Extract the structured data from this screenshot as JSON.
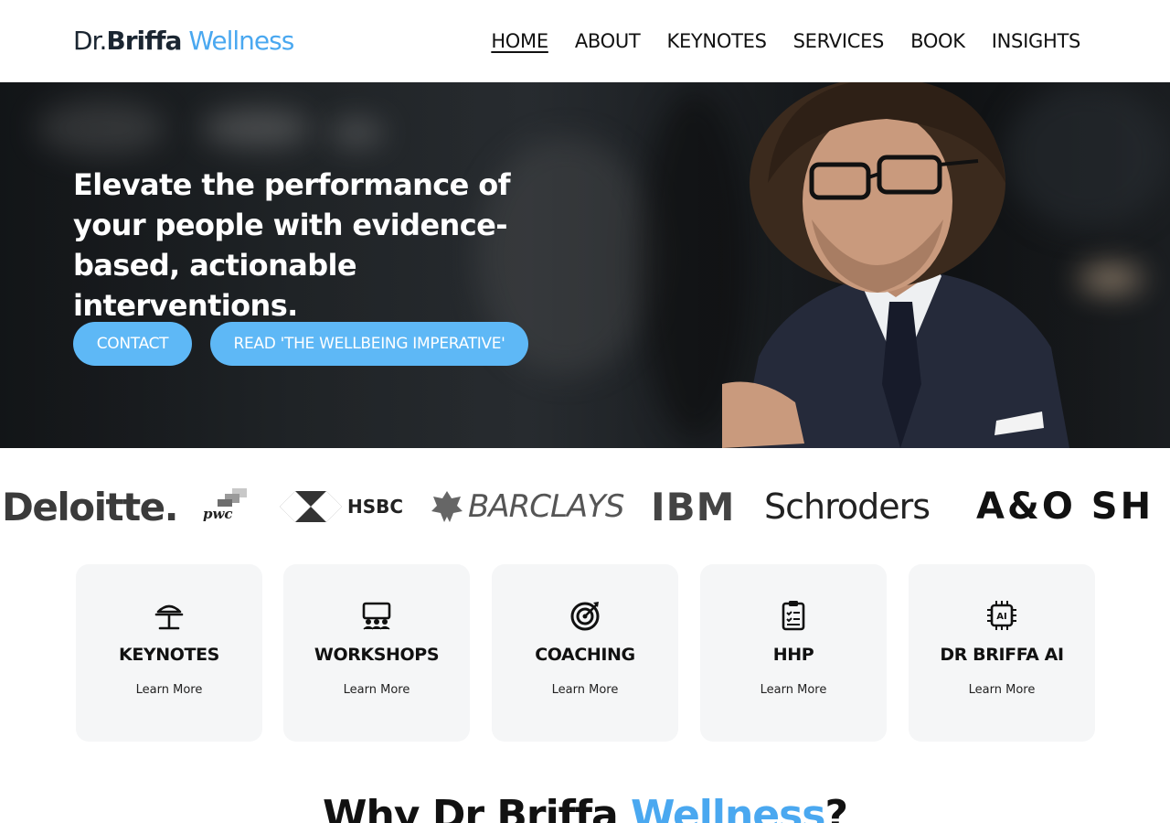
{
  "brand": {
    "dr": "Dr.",
    "briffa": "Briffa",
    "wellness": "Wellness"
  },
  "nav": {
    "home": "HOME",
    "about": "ABOUT",
    "keynotes": "KEYNOTES",
    "services": "SERVICES",
    "book": "BOOK",
    "insights": "INSIGHTS"
  },
  "hero": {
    "headline": "Elevate the performance of your people with evidence-based, actionable interventions.",
    "contact_button": "CONTACT",
    "read_button": "READ 'THE WELLBEING IMPERATIVE'"
  },
  "clients": {
    "deloitte": "Deloitte",
    "deloitte_dot": ".",
    "pwc": "pwc",
    "hsbc": "HSBC",
    "barclays": "BARCLAYS",
    "ibm": "IBM",
    "schroders": "Schroders",
    "ao": "A&O SH"
  },
  "services": [
    {
      "title": "KEYNOTES",
      "link": "Learn More",
      "icon": "podium-icon"
    },
    {
      "title": "WORKSHOPS",
      "link": "Learn More",
      "icon": "presentation-group-icon"
    },
    {
      "title": "COACHING",
      "link": "Learn More",
      "icon": "target-icon"
    },
    {
      "title": "HHP",
      "link": "Learn More",
      "icon": "clipboard-checklist-icon"
    },
    {
      "title": "DR BRIFFA AI",
      "link": "Learn More",
      "icon": "ai-chip-icon"
    }
  ],
  "why": {
    "prefix": "Why Dr Briffa ",
    "accent": "Wellness",
    "suffix": "?"
  },
  "colors": {
    "accent": "#4aa8f0",
    "button": "#5eb8f6",
    "card_bg": "#f5f6f7",
    "logo_dark": "#1b2632"
  }
}
